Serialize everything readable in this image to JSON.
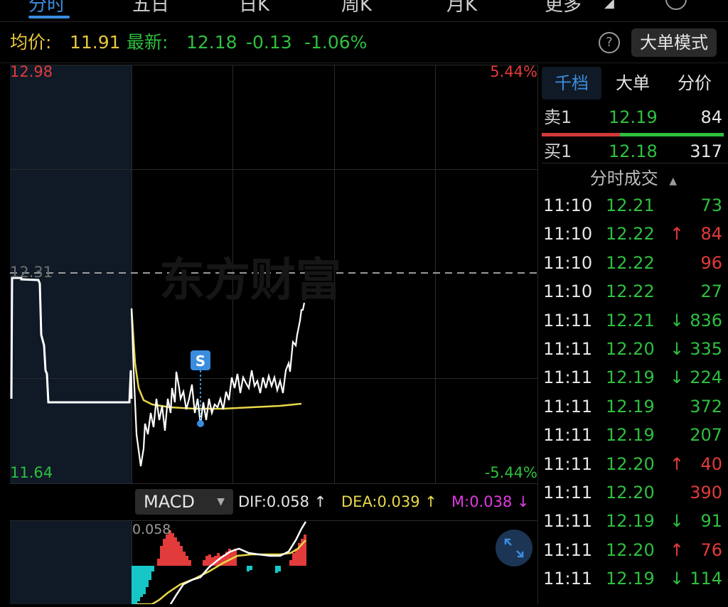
{
  "nav": {
    "tabs": [
      {
        "label": "分时"
      },
      {
        "label": "五日"
      },
      {
        "label": "日K"
      },
      {
        "label": "周K"
      },
      {
        "label": "月K"
      },
      {
        "label": "更多"
      }
    ]
  },
  "info": {
    "avg_label": "均价:",
    "avg_value": "11.91",
    "latest_label": "最新:",
    "latest_value": "12.18",
    "change": "-0.13",
    "change_pct": "-1.06%",
    "help": "?",
    "mode_button": "大单模式"
  },
  "chart": {
    "y_top": "12.98",
    "y_mid": "12.31",
    "y_bottom": "11.64",
    "pct_top": "5.44%",
    "pct_bottom": "-5.44%",
    "watermark": "东方财富",
    "marker": "S",
    "colors": {
      "price": "#ffffff",
      "avg": "#e8d84a",
      "up": "#e23b3b",
      "down": "#2fbf3f",
      "accent": "#3a8dde"
    }
  },
  "macd": {
    "selector": "MACD",
    "dif": "DIF:0.058 ↑",
    "dea": "DEA:0.039 ↑",
    "m": "M:0.038 ↓",
    "axis_value": "0.058"
  },
  "panel": {
    "tabs": [
      "千档",
      "大单",
      "分价"
    ],
    "sell1": {
      "label": "卖1",
      "price": "12.19",
      "vol": "84"
    },
    "buy1": {
      "label": "买1",
      "price": "12.18",
      "vol": "317"
    },
    "section_title": "分时成交",
    "ticks": [
      {
        "time": "11:10",
        "price": "12.21",
        "arrow": "",
        "vol": "73",
        "dir": "down"
      },
      {
        "time": "11:10",
        "price": "12.22",
        "arrow": "↑",
        "vol": "84",
        "dir": "up"
      },
      {
        "time": "11:10",
        "price": "12.22",
        "arrow": "",
        "vol": "96",
        "dir": "up"
      },
      {
        "time": "11:10",
        "price": "12.22",
        "arrow": "",
        "vol": "27",
        "dir": "down"
      },
      {
        "time": "11:11",
        "price": "12.21",
        "arrow": "↓",
        "vol": "836",
        "dir": "down"
      },
      {
        "time": "11:11",
        "price": "12.20",
        "arrow": "↓",
        "vol": "335",
        "dir": "down"
      },
      {
        "time": "11:11",
        "price": "12.19",
        "arrow": "↓",
        "vol": "224",
        "dir": "down"
      },
      {
        "time": "11:11",
        "price": "12.19",
        "arrow": "",
        "vol": "372",
        "dir": "down"
      },
      {
        "time": "11:11",
        "price": "12.19",
        "arrow": "",
        "vol": "207",
        "dir": "down"
      },
      {
        "time": "11:11",
        "price": "12.20",
        "arrow": "↑",
        "vol": "40",
        "dir": "up"
      },
      {
        "time": "11:11",
        "price": "12.20",
        "arrow": "",
        "vol": "390",
        "dir": "up"
      },
      {
        "time": "11:11",
        "price": "12.19",
        "arrow": "↓",
        "vol": "91",
        "dir": "down"
      },
      {
        "time": "11:11",
        "price": "12.20",
        "arrow": "↑",
        "vol": "76",
        "dir": "up"
      },
      {
        "time": "11:11",
        "price": "12.19",
        "arrow": "↓",
        "vol": "114",
        "dir": "down"
      }
    ]
  }
}
